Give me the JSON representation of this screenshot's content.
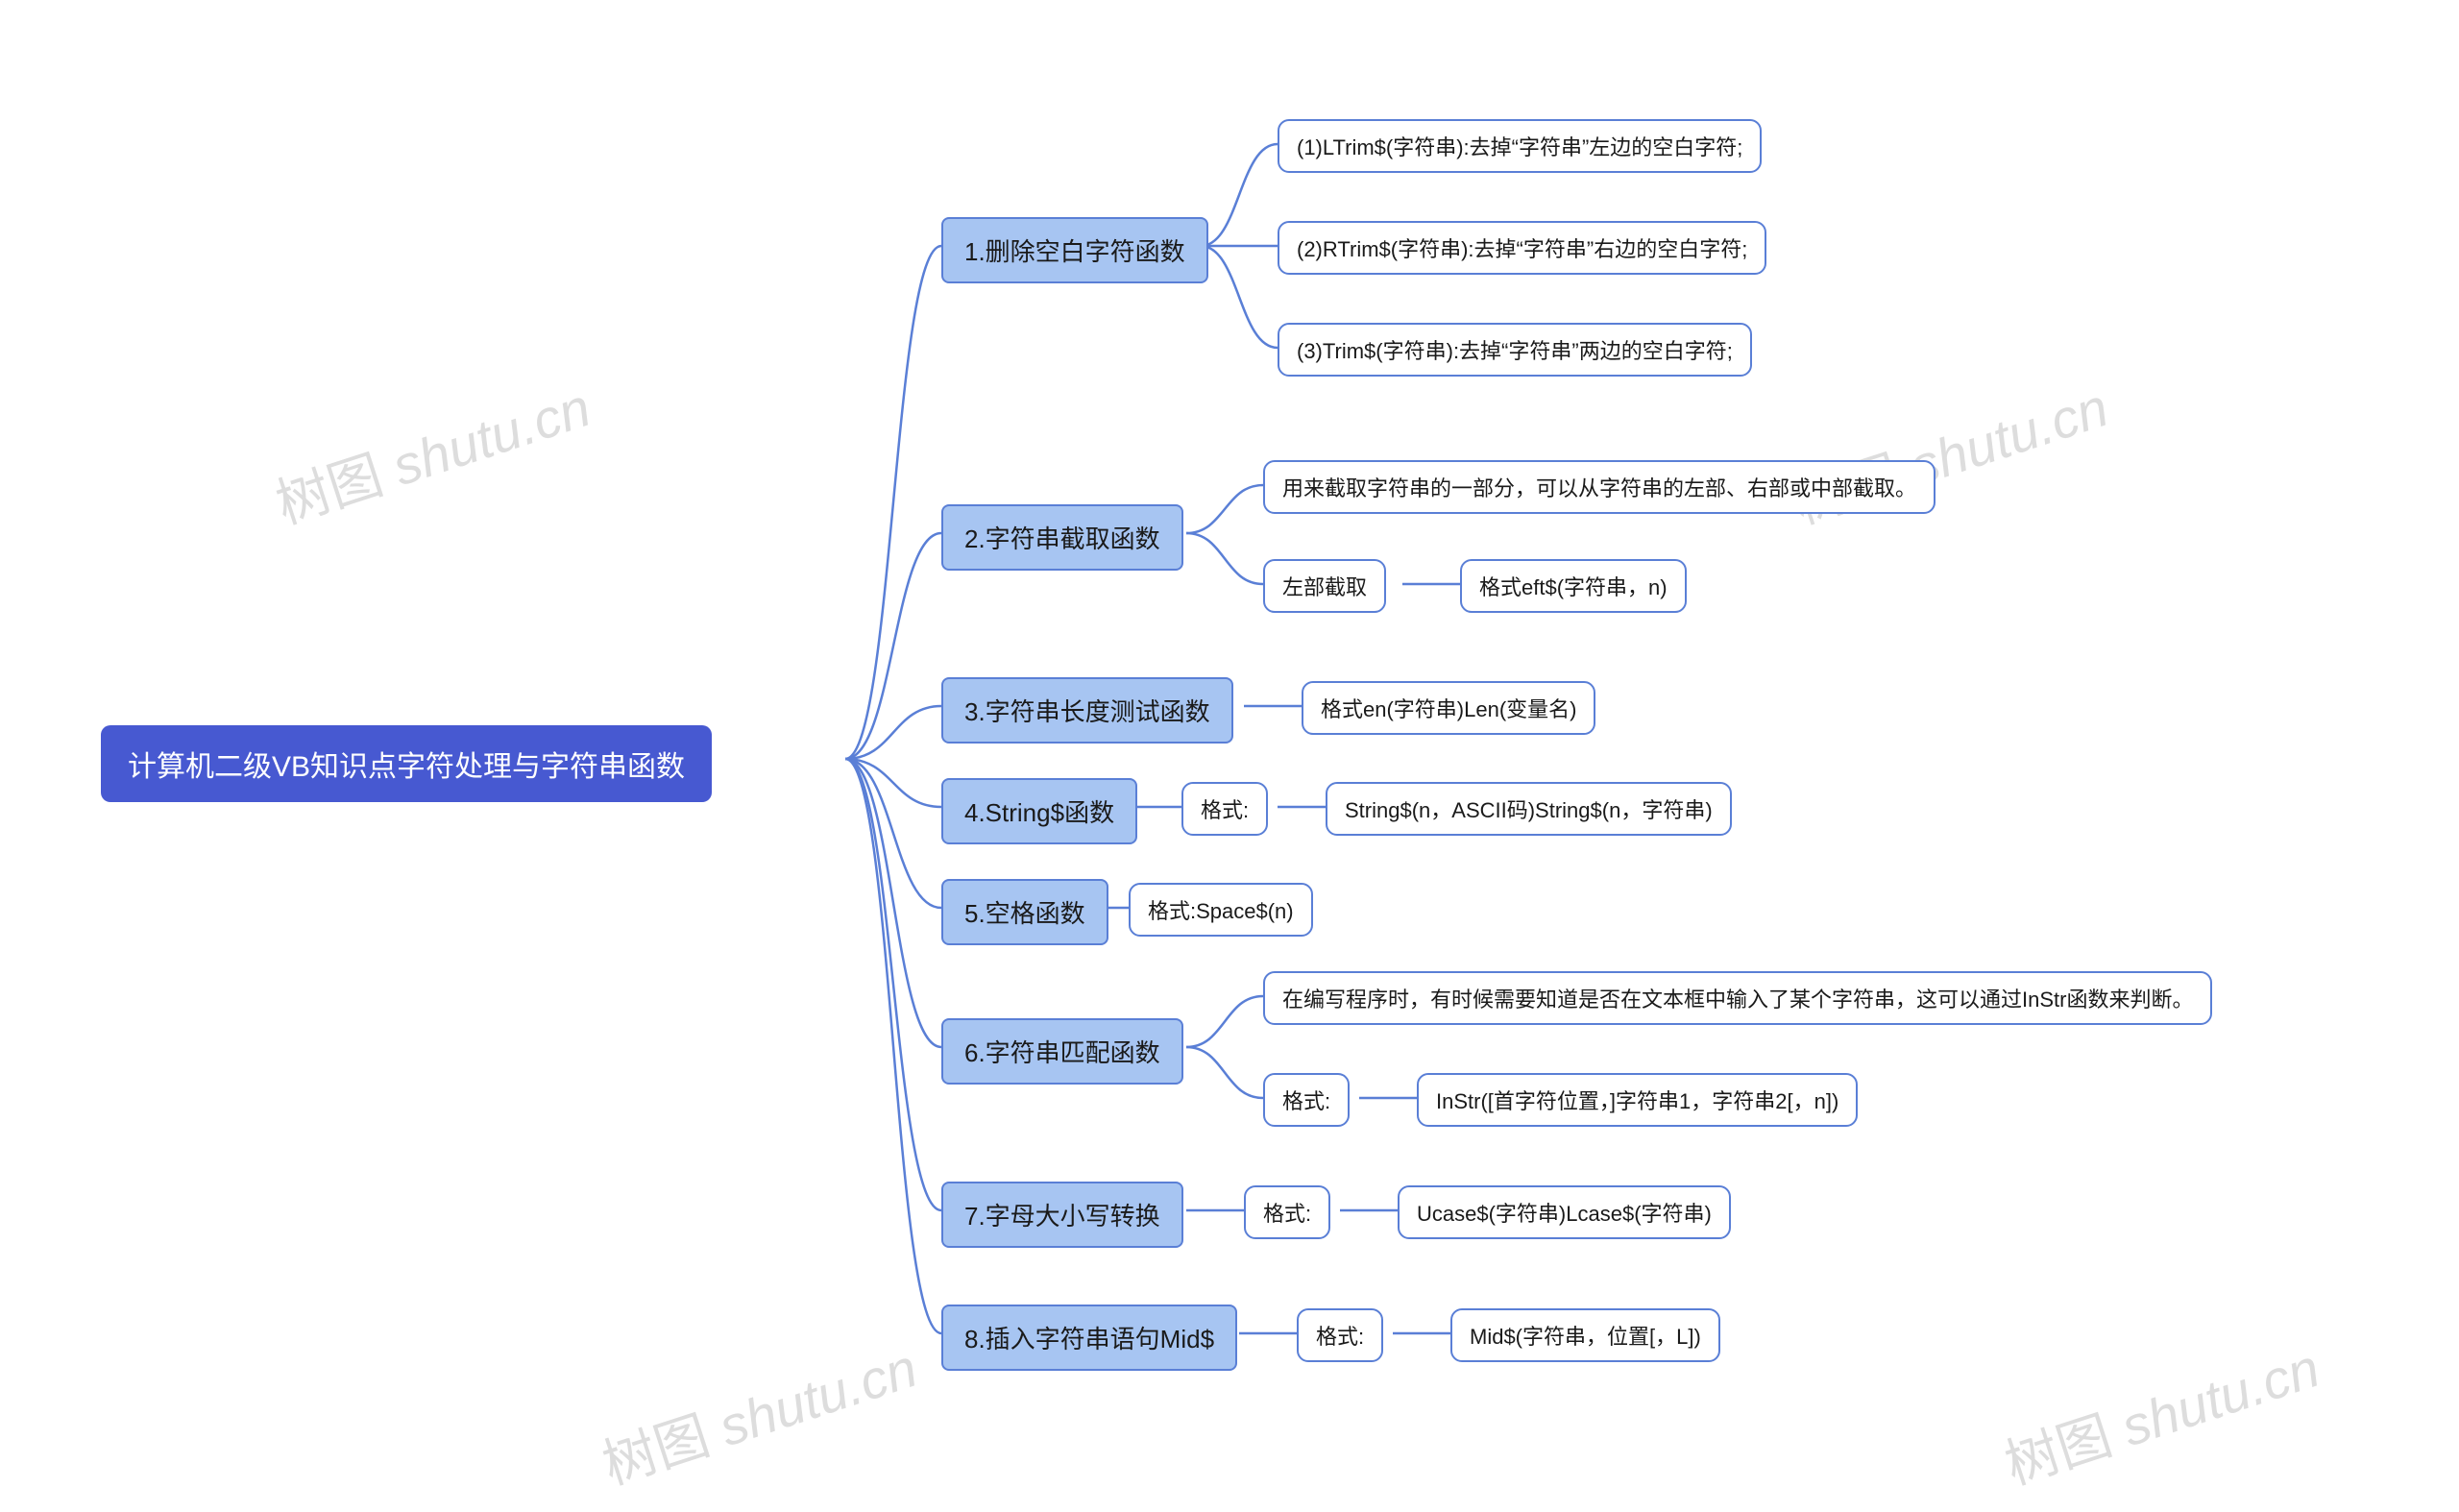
{
  "watermark": {
    "zh": "树图",
    "en": "shutu.cn"
  },
  "root": "计算机二级VB知识点字符处理与字符串函数",
  "branches": [
    {
      "label": "1.删除空白字符函数",
      "children": [
        {
          "label": "(1)LTrim$(字符串):去掉“字符串”左边的空白字符;"
        },
        {
          "label": "(2)RTrim$(字符串):去掉“字符串”右边的空白字符;"
        },
        {
          "label": "(3)Trim$(字符串):去掉“字符串”两边的空白字符;"
        }
      ]
    },
    {
      "label": "2.字符串截取函数",
      "children": [
        {
          "label": "用来截取字符串的一部分，可以从字符串的左部、右部或中部截取。"
        },
        {
          "label": "左部截取",
          "children": [
            {
              "label": "格式eft$(字符串，n)"
            }
          ]
        }
      ]
    },
    {
      "label": "3.字符串长度测试函数",
      "children": [
        {
          "label": "格式en(字符串)Len(变量名)"
        }
      ]
    },
    {
      "label": "4.String$函数",
      "children": [
        {
          "label": "格式:",
          "children": [
            {
              "label": "String$(n，ASCII码)String$(n，字符串)"
            }
          ]
        }
      ]
    },
    {
      "label": "5.空格函数",
      "children": [
        {
          "label": "格式:Space$(n)"
        }
      ]
    },
    {
      "label": "6.字符串匹配函数",
      "children": [
        {
          "label": "在编写程序时，有时候需要知道是否在文本框中输入了某个字符串，这可以通过InStr函数来判断。"
        },
        {
          "label": "格式:",
          "children": [
            {
              "label": "InStr([首字符位置，]字符串1，字符串2[，n])"
            }
          ]
        }
      ]
    },
    {
      "label": "7.字母大小写转换",
      "children": [
        {
          "label": "格式:",
          "children": [
            {
              "label": "Ucase$(字符串)Lcase$(字符串)"
            }
          ]
        }
      ]
    },
    {
      "label": "8.插入字符串语句Mid$",
      "children": [
        {
          "label": "格式:",
          "children": [
            {
              "label": "Mid$(字符串，位置[，L])"
            }
          ]
        }
      ]
    }
  ]
}
